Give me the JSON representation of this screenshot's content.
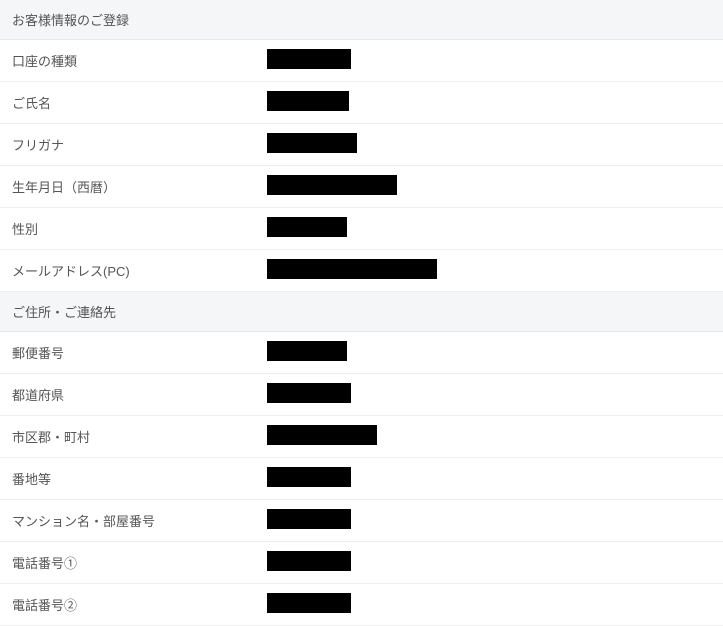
{
  "sections": [
    {
      "title": "お客様情報のご登録",
      "rows": [
        {
          "label": "口座の種類",
          "redactedClass": "w84"
        },
        {
          "label": "ご氏名",
          "redactedClass": "w82"
        },
        {
          "label": "フリガナ",
          "redactedClass": "w90"
        },
        {
          "label": "生年月日（西暦）",
          "redactedClass": "w130"
        },
        {
          "label": "性別",
          "redactedClass": "w80"
        },
        {
          "label": "メールアドレス(PC)",
          "redactedClass": "w170"
        }
      ]
    },
    {
      "title": "ご住所・ご連絡先",
      "rows": [
        {
          "label": "郵便番号",
          "redactedClass": "w80"
        },
        {
          "label": "都道府県",
          "redactedClass": "w84"
        },
        {
          "label": "市区郡・町村",
          "redactedClass": "w110"
        },
        {
          "label": "番地等",
          "redactedClass": "w84"
        },
        {
          "label": "マンション名・部屋番号",
          "redactedClass": "w84"
        },
        {
          "label": "電話番号①",
          "redactedClass": "w84"
        },
        {
          "label": "電話番号②",
          "redactedClass": "w84"
        }
      ]
    }
  ]
}
